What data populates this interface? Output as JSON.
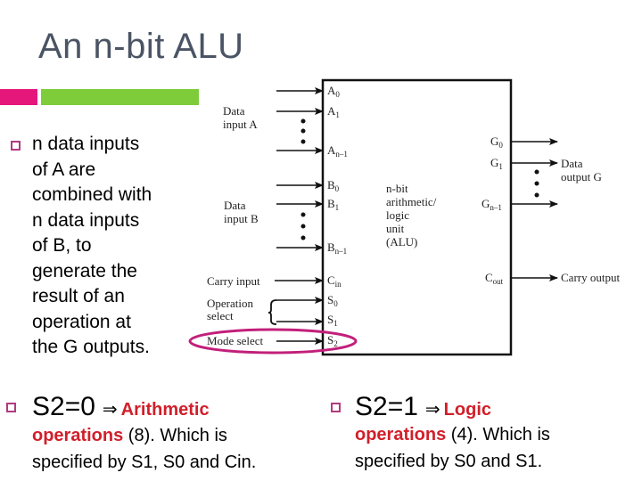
{
  "slide": {
    "title": "An n-bit ALU",
    "accent_colors": {
      "pink_bar": "#e5177b",
      "green_bar": "#7fcc3b",
      "bullet": "#b03a82",
      "highlight": "#d11f2a",
      "ellipse": "#c21f7a"
    },
    "bullet_1": {
      "lines": [
        "n data inputs",
        "of A are",
        "combined with",
        "n data inputs",
        "of B, to",
        "generate the",
        "result of an",
        "operation at",
        "the G outputs."
      ]
    },
    "bullet_2": {
      "lead": "S2=0",
      "arrow": "⇒",
      "highlight_1": "Arithmetic",
      "highlight_2": "operations",
      "rest_line_2": " (8). Which is",
      "line_3": "specified by S1, S0 and Cin."
    },
    "bullet_3": {
      "lead": "S2=1",
      "arrow": "⇒",
      "highlight_1": "Logic",
      "highlight_2": "operations",
      "rest_line_2": " (4). Which is",
      "line_3": "specified by S0 and S1."
    }
  },
  "diagram": {
    "box_label": [
      "n-bit",
      "arithmetic/",
      "logic",
      "unit",
      "(ALU)"
    ],
    "data_input_a": [
      "Data",
      "input A"
    ],
    "data_input_b": [
      "Data",
      "input B"
    ],
    "carry_input": "Carry input",
    "operation_select": [
      "Operation",
      "select"
    ],
    "mode_select": "Mode select",
    "data_output_g": [
      "Data",
      "output G"
    ],
    "carry_output": "Carry output",
    "pins_a": [
      {
        "base": "A",
        "sub": "0"
      },
      {
        "base": "A",
        "sub": "1"
      },
      {
        "base": "A",
        "sub": "n–1"
      }
    ],
    "pins_b": [
      {
        "base": "B",
        "sub": "0"
      },
      {
        "base": "B",
        "sub": "1"
      },
      {
        "base": "B",
        "sub": "n–1"
      }
    ],
    "pin_cin": {
      "base": "C",
      "sub": "in"
    },
    "pins_s": [
      {
        "base": "S",
        "sub": "0"
      },
      {
        "base": "S",
        "sub": "1"
      },
      {
        "base": "S",
        "sub": "2"
      }
    ],
    "pins_g": [
      {
        "base": "G",
        "sub": "0"
      },
      {
        "base": "G",
        "sub": "1"
      },
      {
        "base": "G",
        "sub": "n–1"
      }
    ],
    "pin_cout": {
      "base": "C",
      "sub": "out"
    }
  }
}
